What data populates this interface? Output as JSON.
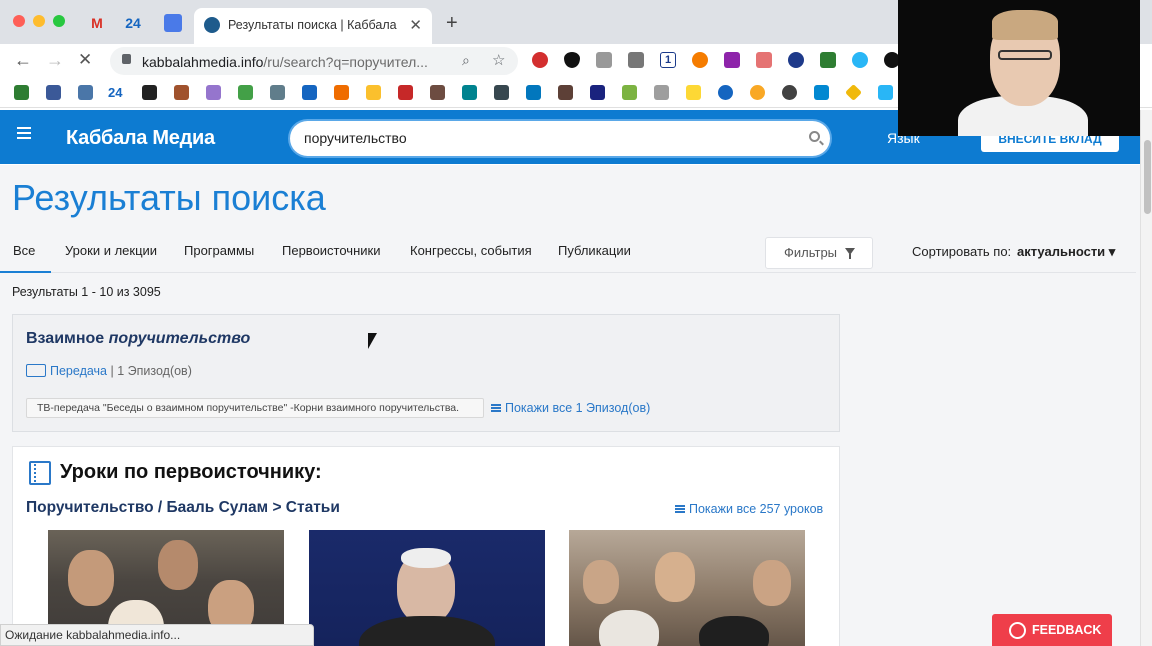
{
  "browser": {
    "active_tab_title": "Результаты поиска | Каббала",
    "tab_close": "✕",
    "new_tab": "+",
    "pinned_24": "24",
    "pinned_gmail": "M",
    "url_host": "kabbalahmedia.info",
    "url_path": "/ru/search?q=поручител...",
    "ext_24": "24"
  },
  "site": {
    "logo": "Каббала Медиа",
    "search_value": "поручительство",
    "language": "Язык",
    "donate": "ВНЕСИТЕ ВКЛАД"
  },
  "page": {
    "title": "Результаты поиска",
    "tabs": [
      {
        "label": "Все"
      },
      {
        "label": "Уроки и лекции"
      },
      {
        "label": "Программы"
      },
      {
        "label": "Первоисточники"
      },
      {
        "label": "Конгрессы, события"
      },
      {
        "label": "Публикации"
      }
    ],
    "filters": "Фильтры",
    "sort_label": "Сортировать по:",
    "sort_value": "актуальности ▾",
    "results_count": "Результаты 1 - 10 из 3095"
  },
  "result1": {
    "title_plain": "Взаимное ",
    "title_italic": "поручительство",
    "type_link": "Передача",
    "episodes": "| 1 Эпизод(ов)",
    "episode_chip": "ТВ-передача \"Беседы о взаимном поручительстве\" -Корни взаимного поручительства.",
    "show_all": "Покажи все 1 Эпизод(ов)"
  },
  "result2": {
    "heading": "Уроки по первоисточнику:",
    "subheading": "Поручительство / Бааль Сулам > Статьи",
    "show_all": "Покажи все 257 уроков"
  },
  "status": {
    "loading": "Ожидание kabbalahmedia.info...",
    "feedback": "FEEDBACK"
  }
}
